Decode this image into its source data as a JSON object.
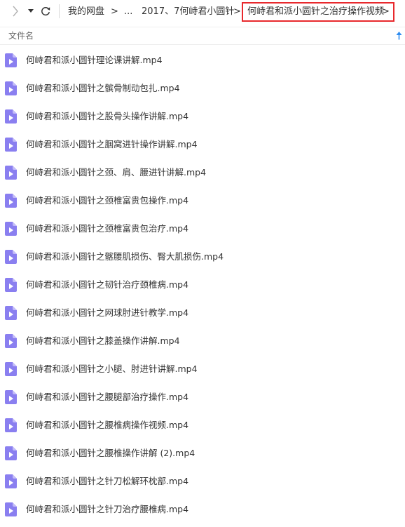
{
  "toolbar": {
    "forward_icon": "chevron-right-icon",
    "history_icon": "caret-down-icon",
    "refresh_icon": "refresh-icon"
  },
  "breadcrumb": {
    "items": [
      "我的网盘",
      "...",
      "2017、7何峙君小圆针",
      "何峙君和派小圆针之治疗操作视频"
    ],
    "separator": ">",
    "highlight_color": "#e8292d"
  },
  "list_header": {
    "column_label": "文件名",
    "sort_icon": "sort-up-arrow-icon",
    "sort_color": "#2d8cf0"
  },
  "file_icon_color": "#8a7ff0",
  "files": [
    {
      "name": "何峙君和派小圆针理论课讲解.mp4"
    },
    {
      "name": "何峙君和派小圆针之髌骨制动包扎.mp4"
    },
    {
      "name": "何峙君和派小圆针之股骨头操作讲解.mp4"
    },
    {
      "name": "何峙君和派小圆针之腘窝进针操作讲解.mp4"
    },
    {
      "name": "何峙君和派小圆针之颈、肩、腰进针讲解.mp4"
    },
    {
      "name": "何峙君和派小圆针之颈椎富贵包操作.mp4"
    },
    {
      "name": "何峙君和派小圆针之颈椎富贵包治疗.mp4"
    },
    {
      "name": "何峙君和派小圆针之髂腰肌损伤、臀大肌损伤.mp4"
    },
    {
      "name": "何峙君和派小圆针之韧针治疗颈椎病.mp4"
    },
    {
      "name": "何峙君和派小圆针之网球肘进针教学.mp4"
    },
    {
      "name": "何峙君和派小圆针之膝盖操作讲解.mp4"
    },
    {
      "name": "何峙君和派小圆针之小腿、肘进针讲解.mp4"
    },
    {
      "name": "何峙君和派小圆针之腰腿部治疗操作.mp4"
    },
    {
      "name": "何峙君和派小圆针之腰椎病操作视频.mp4"
    },
    {
      "name": "何峙君和派小圆针之腰椎操作讲解 (2).mp4"
    },
    {
      "name": "何峙君和派小圆针之针刀松解环枕部.mp4"
    },
    {
      "name": "何峙君和派小圆针之针刀治疗腰椎病.mp4"
    }
  ]
}
